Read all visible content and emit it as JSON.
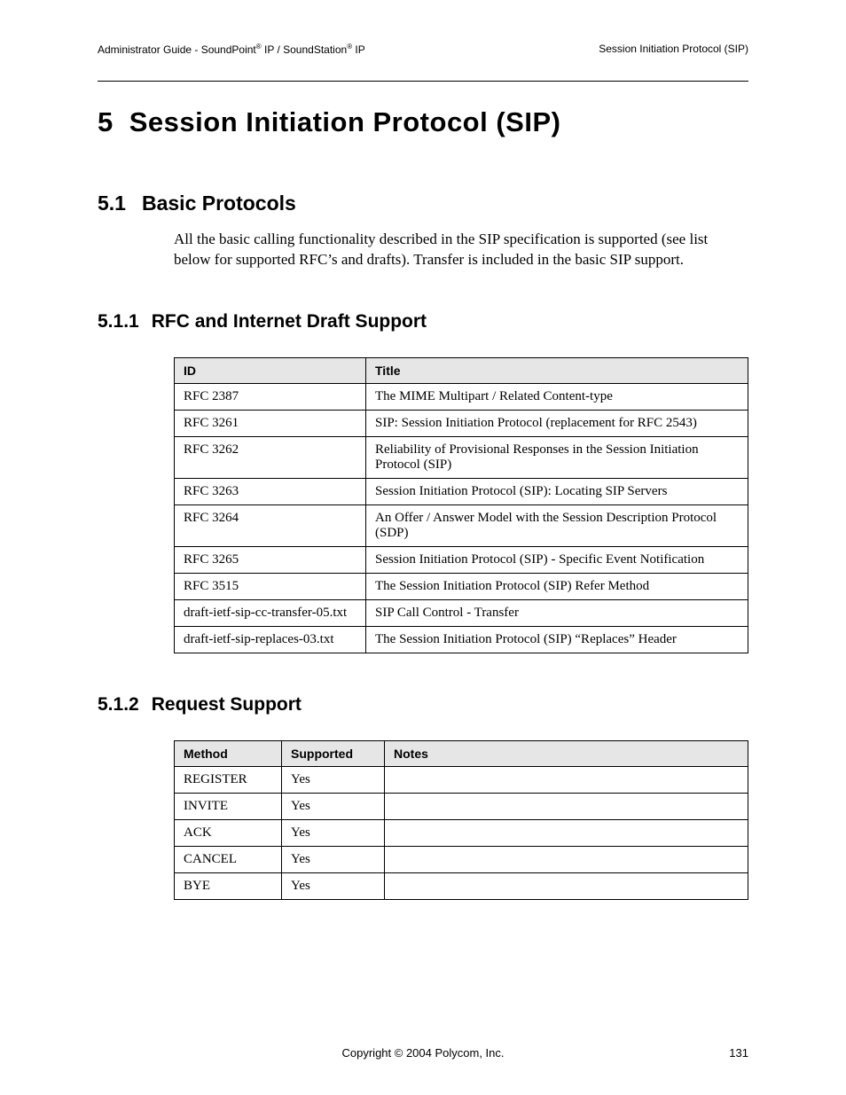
{
  "header": {
    "left_prefix": "Administrator Guide - SoundPoint",
    "left_mid": " IP / SoundStation",
    "left_suffix": " IP",
    "right": "Session Initiation Protocol (SIP)"
  },
  "chapter": {
    "num": "5",
    "title": "Session Initiation Protocol (SIP)"
  },
  "s51": {
    "num": "5.1",
    "title": "Basic Protocols",
    "para": "All the basic calling functionality described in the SIP specification is supported (see list below for supported RFC’s and drafts). Transfer is included in the basic SIP support."
  },
  "s511": {
    "num": "5.1.1",
    "title": "RFC and Internet Draft Support",
    "headers": {
      "id": "ID",
      "title": "Title"
    },
    "rows": [
      {
        "id": "RFC 2387",
        "title": "The MIME Multipart / Related Content-type"
      },
      {
        "id": "RFC 3261",
        "title": "SIP: Session Initiation Protocol (replacement for RFC 2543)"
      },
      {
        "id": "RFC 3262",
        "title": "Reliability of Provisional Responses in the Session Initiation Protocol (SIP)"
      },
      {
        "id": "RFC 3263",
        "title": "Session Initiation Protocol (SIP): Locating SIP Servers"
      },
      {
        "id": "RFC 3264",
        "title": "An Offer / Answer Model with the Session Description Protocol (SDP)"
      },
      {
        "id": "RFC 3265",
        "title": "Session Initiation Protocol (SIP) - Specific Event Notification"
      },
      {
        "id": "RFC 3515",
        "title": "The Session Initiation Protocol (SIP) Refer Method"
      },
      {
        "id": "draft-ietf-sip-cc-transfer-05.txt",
        "title": "SIP Call Control - Transfer"
      },
      {
        "id": "draft-ietf-sip-replaces-03.txt",
        "title": "The Session Initiation Protocol (SIP) “Replaces” Header"
      }
    ]
  },
  "s512": {
    "num": "5.1.2",
    "title": "Request Support",
    "headers": {
      "method": "Method",
      "supported": "Supported",
      "notes": "Notes"
    },
    "rows": [
      {
        "method": "REGISTER",
        "supported": "Yes",
        "notes": ""
      },
      {
        "method": "INVITE",
        "supported": "Yes",
        "notes": ""
      },
      {
        "method": "ACK",
        "supported": "Yes",
        "notes": ""
      },
      {
        "method": "CANCEL",
        "supported": "Yes",
        "notes": ""
      },
      {
        "method": "BYE",
        "supported": "Yes",
        "notes": ""
      }
    ]
  },
  "footer": {
    "copyright": "Copyright © 2004 Polycom, Inc.",
    "page": "131"
  }
}
